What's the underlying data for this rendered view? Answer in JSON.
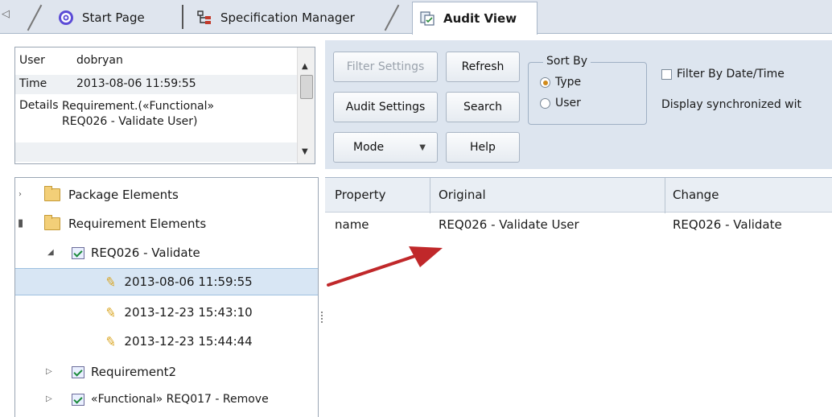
{
  "tabs": [
    {
      "label": "Start Page"
    },
    {
      "label": "Specification Manager"
    },
    {
      "label": "Audit View"
    }
  ],
  "details": {
    "user_key": "User",
    "user_val": "dobryan",
    "time_key": "Time",
    "time_val": "2013-08-06 11:59:55",
    "details_key": "Details",
    "details_val_line1": "Requirement.(«Functional»",
    "details_val_line2": "REQ026 - Validate User)"
  },
  "toolbar": {
    "filter_settings": "Filter Settings",
    "refresh": "Refresh",
    "audit_settings": "Audit Settings",
    "search": "Search",
    "mode": "Mode",
    "help": "Help",
    "sort_by": "Sort By",
    "sort_type": "Type",
    "sort_user": "User",
    "sort_selected": "Type",
    "filter_date": "Filter By Date/Time",
    "display_sync": "Display synchronized wit"
  },
  "tree": [
    {
      "label": "Package Elements"
    },
    {
      "label": "Requirement Elements"
    },
    {
      "label": "REQ026 - Validate"
    },
    {
      "label": "2013-08-06 11:59:55"
    },
    {
      "label": "2013-12-23 15:43:10"
    },
    {
      "label": "2013-12-23 15:44:44"
    },
    {
      "label": "Requirement2"
    },
    {
      "label": "«Functional» REQ017 - Remove"
    }
  ],
  "grid": {
    "columns": [
      "Property",
      "Original",
      "Change"
    ],
    "rows": [
      [
        "name",
        "REQ026 - Validate User",
        "REQ026 - Validate"
      ]
    ]
  },
  "colors": {
    "accent_arrow": "#c0282a",
    "selection": "#d8e6f4",
    "toolbar_bg": "#dde5ef"
  }
}
